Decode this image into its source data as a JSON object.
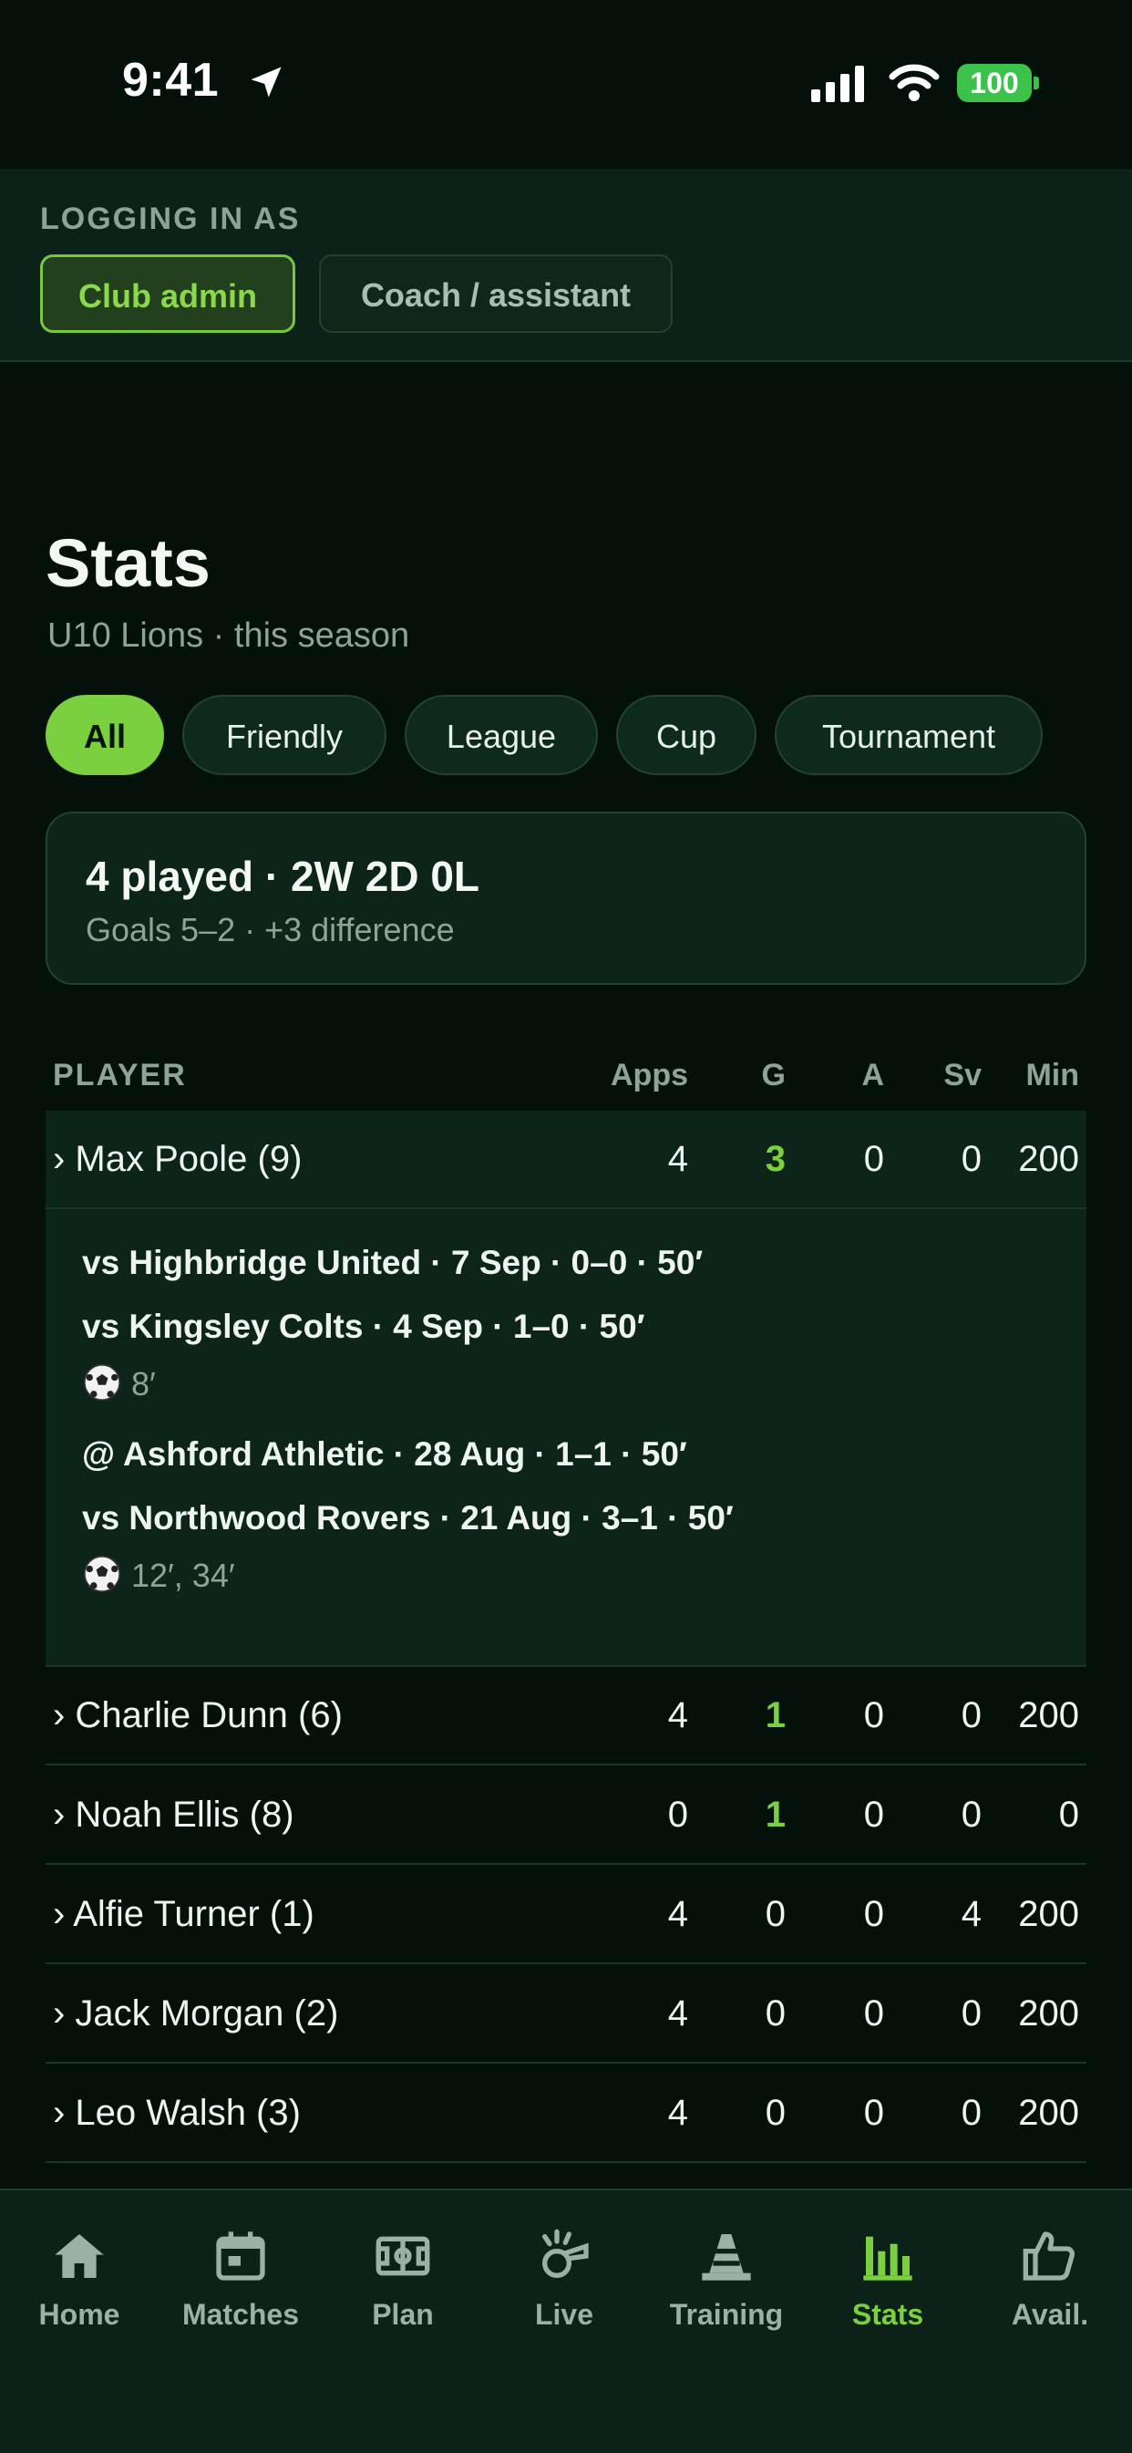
{
  "status_bar": {
    "time": "9:41",
    "battery": "100"
  },
  "login": {
    "title": "LOGGING IN AS",
    "roles": [
      "Club admin",
      "Coach / assistant"
    ],
    "active_role": "Club admin"
  },
  "page": {
    "title": "Stats",
    "subtitle": "U10 Lions · this season"
  },
  "filters": [
    {
      "label": "All",
      "active": true
    },
    {
      "label": "Friendly",
      "active": false
    },
    {
      "label": "League",
      "active": false
    },
    {
      "label": "Cup",
      "active": false
    },
    {
      "label": "Tournament",
      "active": false
    }
  ],
  "summary": {
    "main": "4 played · 2W 2D 0L",
    "sub": "Goals 5–2 · +3 difference"
  },
  "table": {
    "headers": [
      "PLAYER",
      "Apps",
      "G",
      "A",
      "Sv",
      "Min"
    ],
    "rows": [
      {
        "name": "› Max Poole (9)",
        "apps": "4",
        "g": "3",
        "a": "0",
        "sv": "0",
        "min": "200"
      },
      {
        "name": "› Charlie Dunn (6)",
        "apps": "4",
        "g": "1",
        "a": "0",
        "sv": "0",
        "min": "200"
      },
      {
        "name": "› Noah Ellis (8)",
        "apps": "0",
        "g": "1",
        "a": "0",
        "sv": "0",
        "min": "0"
      },
      {
        "name": "› Alfie Turner (1)",
        "apps": "4",
        "g": "0",
        "a": "0",
        "sv": "4",
        "min": "200"
      },
      {
        "name": "› Jack Morgan (2)",
        "apps": "4",
        "g": "0",
        "a": "0",
        "sv": "0",
        "min": "200"
      },
      {
        "name": "› Leo Walsh (3)",
        "apps": "4",
        "g": "0",
        "a": "0",
        "sv": "0",
        "min": "200"
      }
    ]
  },
  "detail": {
    "matches": [
      {
        "line": "vs Highbridge United · 7 Sep · 0–0 · 50′",
        "goals": ""
      },
      {
        "line": "vs Kingsley Colts · 4 Sep · 1–0 · 50′",
        "goals": "8′"
      },
      {
        "line": "@ Ashford Athletic · 28 Aug · 1–1 · 50′",
        "goals": ""
      },
      {
        "line": "vs Northwood Rovers · 21 Aug · 3–1 · 50′",
        "goals": "12′, 34′"
      }
    ]
  },
  "nav": {
    "items": [
      {
        "label": "Home",
        "icon": "home-icon"
      },
      {
        "label": "Matches",
        "icon": "calendar-icon"
      },
      {
        "label": "Plan",
        "icon": "pitch-icon"
      },
      {
        "label": "Live",
        "icon": "whistle-icon"
      },
      {
        "label": "Training",
        "icon": "cone-icon"
      },
      {
        "label": "Stats",
        "icon": "bar-chart-icon"
      },
      {
        "label": "Avail.",
        "icon": "thumbs-up-icon"
      }
    ],
    "active": "Stats"
  },
  "colors": {
    "accent": "#7ad03f",
    "background": "#04110b",
    "card": "#0d2419"
  }
}
